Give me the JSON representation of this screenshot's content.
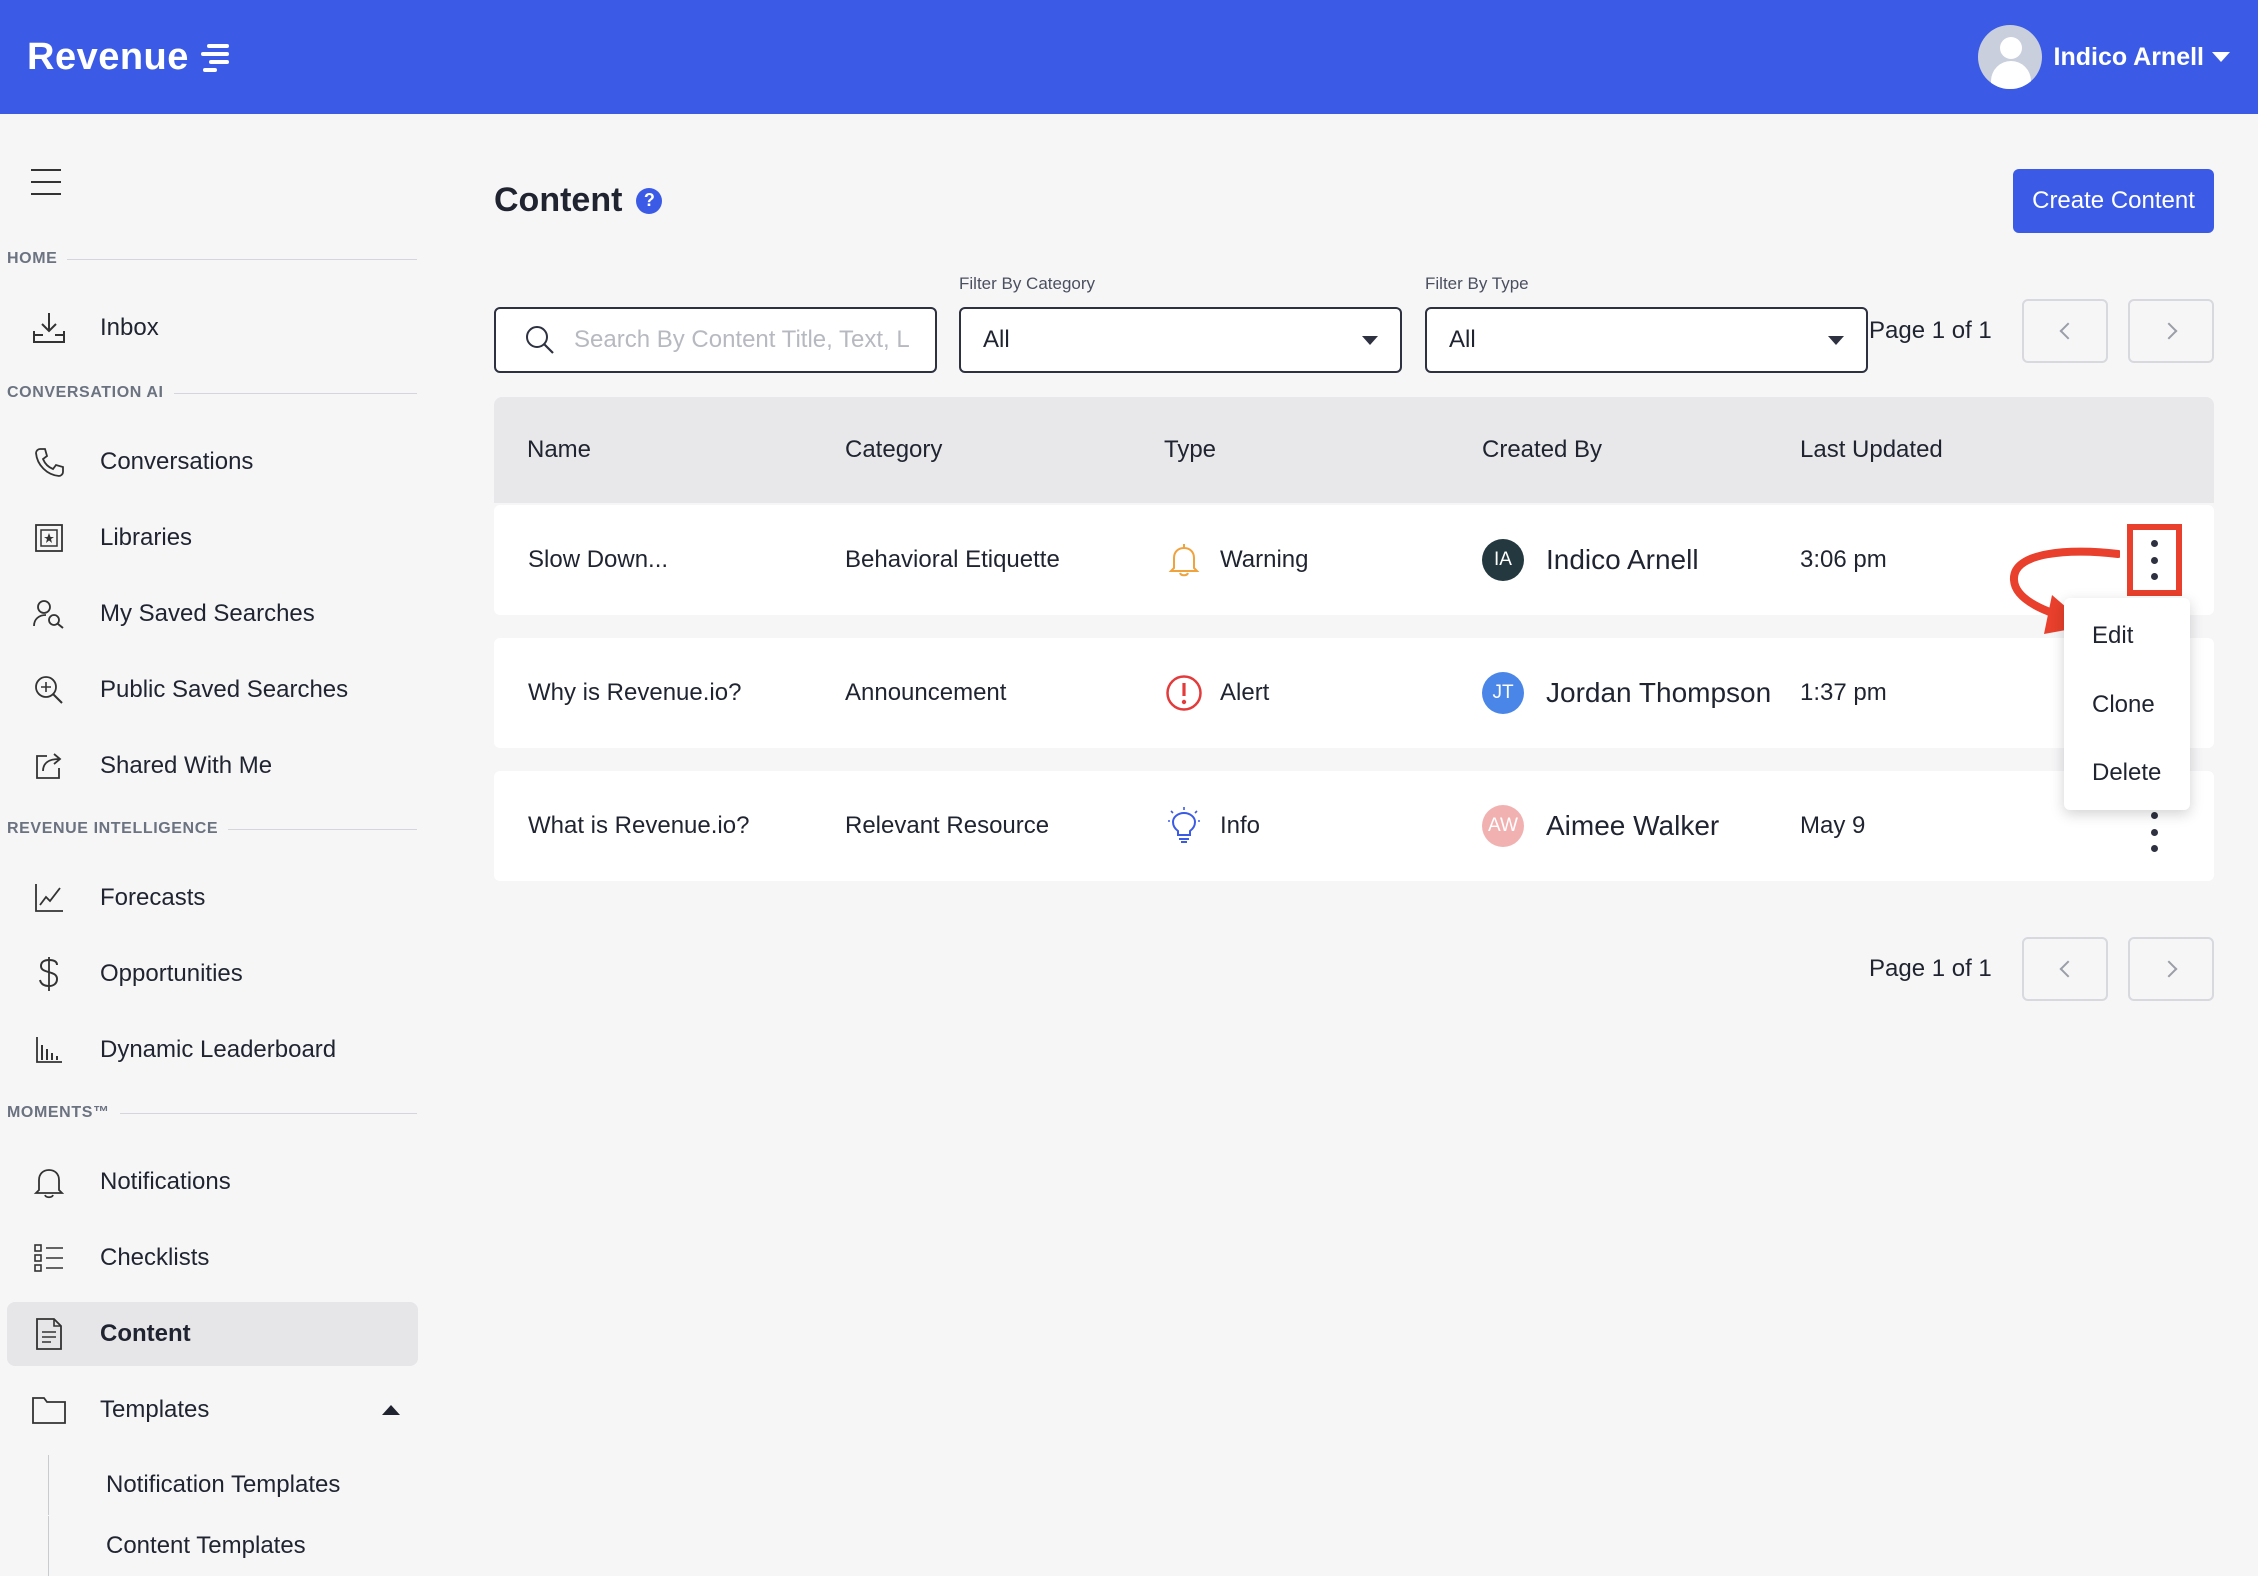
{
  "app": {
    "brand": "Revenue"
  },
  "user": {
    "name": "Indico Arnell"
  },
  "sidebar": {
    "sections": {
      "home": "HOME",
      "conversation_ai": "CONVERSATION AI",
      "revenue_intelligence": "REVENUE INTELLIGENCE",
      "moments": "MOMENTS™"
    },
    "items": {
      "inbox": "Inbox",
      "conversations": "Conversations",
      "libraries": "Libraries",
      "my_saved_searches": "My Saved Searches",
      "public_saved_searches": "Public Saved Searches",
      "shared_with_me": "Shared With Me",
      "forecasts": "Forecasts",
      "opportunities": "Opportunities",
      "dynamic_leaderboard": "Dynamic Leaderboard",
      "notifications": "Notifications",
      "checklists": "Checklists",
      "content": "Content",
      "templates": "Templates",
      "notification_templates": "Notification Templates",
      "content_templates": "Content Templates"
    }
  },
  "main": {
    "title": "Content",
    "help": "?",
    "create_button": "Create Content",
    "search_placeholder": "Search By Content Title, Text, Li",
    "filters": {
      "category_label": "Filter By Category",
      "category_value": "All",
      "type_label": "Filter By Type",
      "type_value": "All"
    },
    "pager_text": "Page 1 of 1"
  },
  "table": {
    "headers": {
      "name": "Name",
      "category": "Category",
      "type": "Type",
      "created_by": "Created By",
      "last_updated": "Last Updated"
    },
    "rows": [
      {
        "name": "Slow Down...",
        "category": "Behavioral Etiquette",
        "type": "Warning",
        "initials": "IA",
        "creator": "Indico Arnell",
        "updated": "3:06 pm",
        "icon": "bell-icon",
        "avatar_color": "#23393f"
      },
      {
        "name": "Why is Revenue.io?",
        "category": "Announcement",
        "type": "Alert",
        "initials": "JT",
        "creator": "Jordan Thompson",
        "updated": "1:37 pm",
        "icon": "alert-circle-icon",
        "avatar_color": "#4a86e8"
      },
      {
        "name": "What is Revenue.io?",
        "category": "Relevant Resource",
        "type": "Info",
        "initials": "AW",
        "creator": "Aimee Walker",
        "updated": "May 9",
        "icon": "lightbulb-icon",
        "avatar_color": "#f2b1b1"
      }
    ]
  },
  "row_menu": {
    "edit": "Edit",
    "clone": "Clone",
    "delete": "Delete"
  },
  "colors": {
    "brand": "#3b5be6",
    "annotation": "#e8402c",
    "warning": "#f0a23c",
    "alert": "#e33b3b",
    "info": "#3b5be6"
  }
}
